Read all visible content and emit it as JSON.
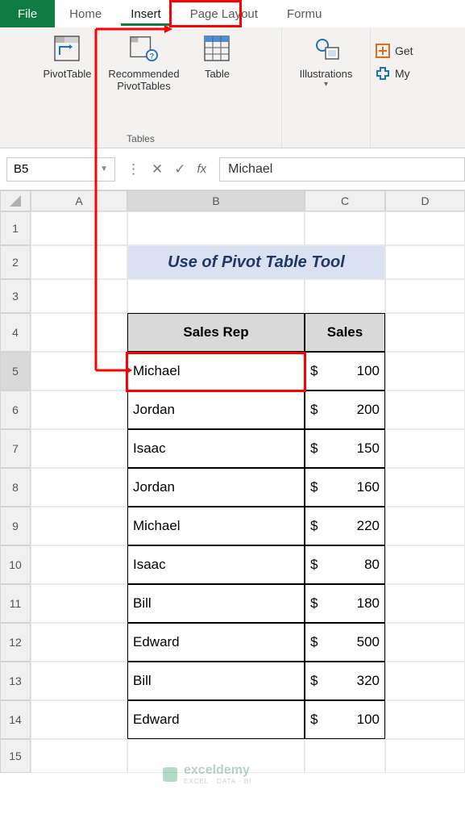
{
  "tabs": {
    "file": "File",
    "home": "Home",
    "insert": "Insert",
    "page_layout": "Page Layout",
    "formulas": "Formu"
  },
  "ribbon": {
    "pivot_table": "PivotTable",
    "rec_pivot": "Recommended\nPivotTables",
    "table": "Table",
    "group_tables": "Tables",
    "illustrations": "Illustrations",
    "get": "Get",
    "my": "My "
  },
  "namebox": "B5",
  "formula_value": "Michael",
  "columns": [
    "A",
    "B",
    "C",
    "D"
  ],
  "title": "Use of Pivot Table Tool",
  "table_headers": {
    "rep": "Sales Rep",
    "sales": "Sales"
  },
  "rows": [
    {
      "rep": "Michael",
      "sales": 100
    },
    {
      "rep": "Jordan",
      "sales": 200
    },
    {
      "rep": "Isaac",
      "sales": 150
    },
    {
      "rep": "Jordan",
      "sales": 160
    },
    {
      "rep": "Michael",
      "sales": 220
    },
    {
      "rep": "Isaac",
      "sales": 80
    },
    {
      "rep": "Bill",
      "sales": 180
    },
    {
      "rep": "Edward",
      "sales": 500
    },
    {
      "rep": "Bill",
      "sales": 320
    },
    {
      "rep": "Edward",
      "sales": 100
    }
  ],
  "currency": "$",
  "watermark": {
    "name": "exceldemy",
    "sub": "EXCEL · DATA · BI"
  }
}
